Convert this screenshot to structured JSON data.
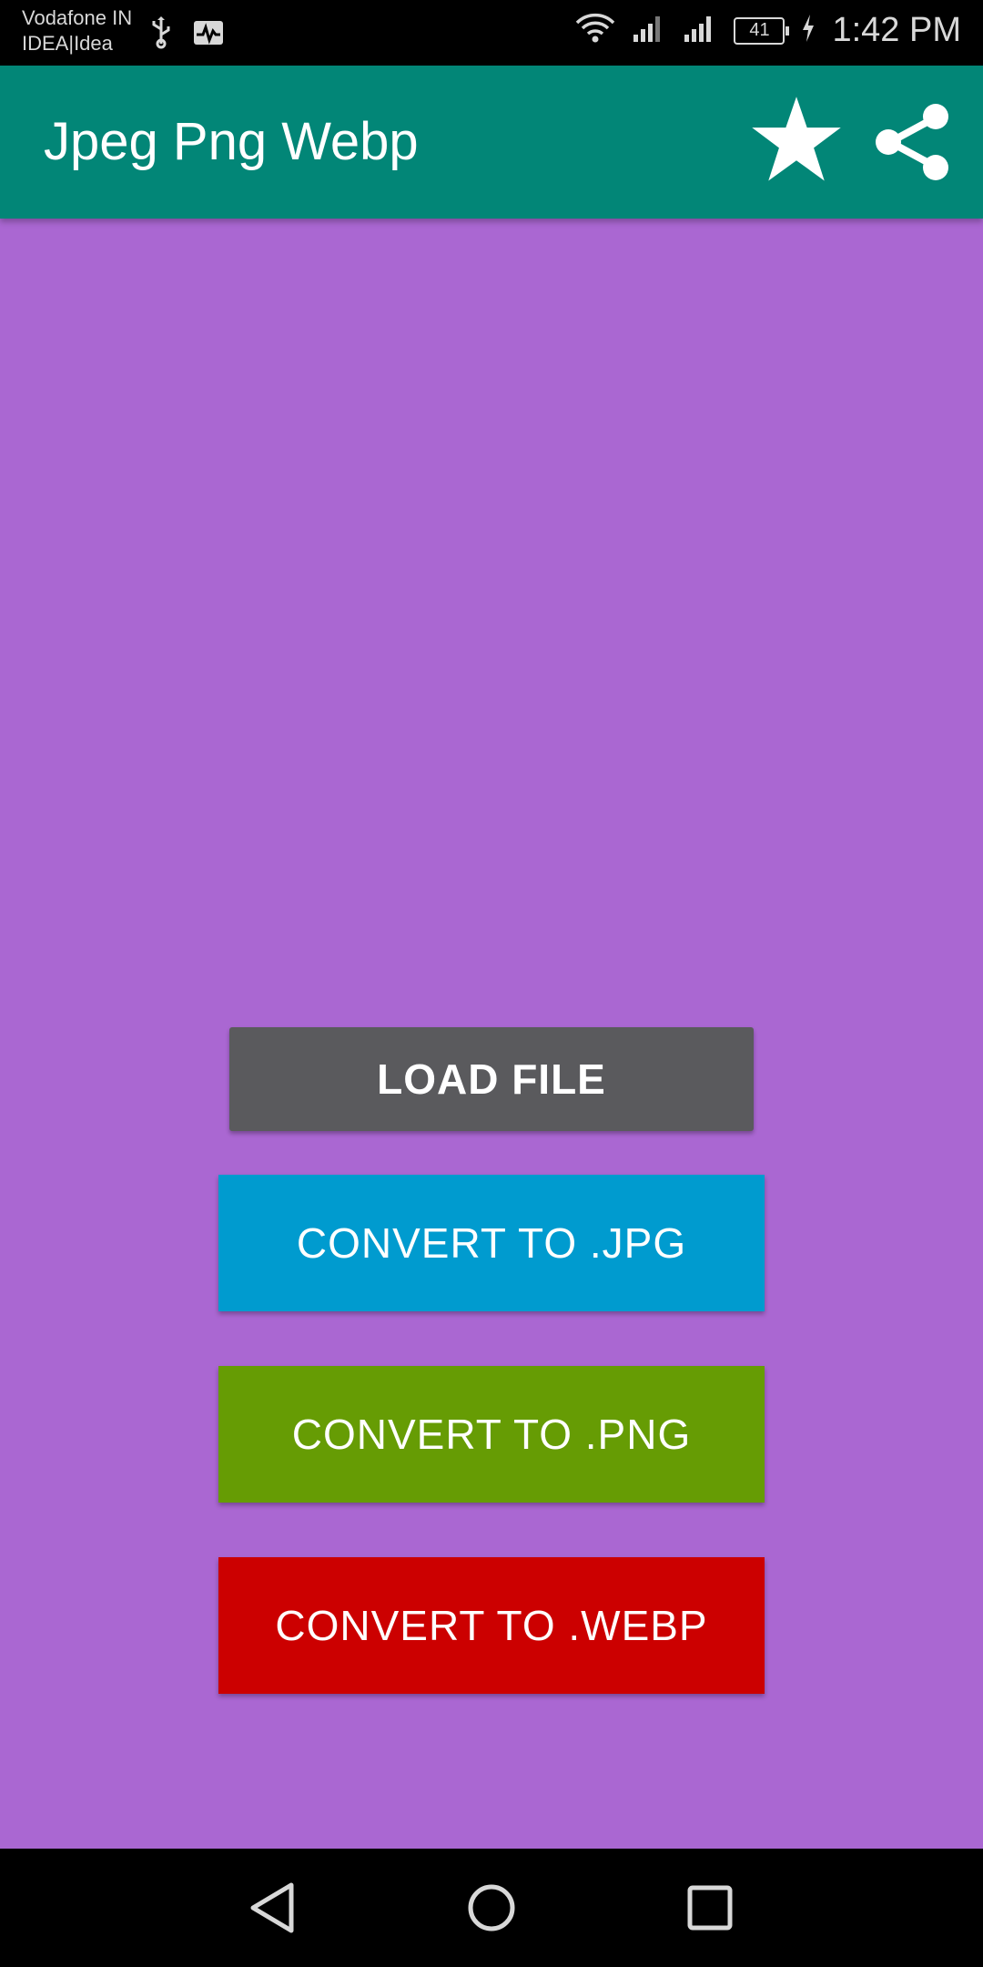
{
  "status_bar": {
    "carrier_line1": "Vodafone IN",
    "carrier_line2": "IDEA|Idea",
    "battery_level": "41",
    "time": "1:42 PM",
    "icons": [
      "usb-icon",
      "activity-icon",
      "wifi-icon",
      "signal-icon",
      "signal-icon",
      "battery-icon",
      "charging-icon"
    ]
  },
  "app_bar": {
    "title": "Jpeg Png Webp",
    "background": "#028677",
    "actions": [
      "star-icon",
      "share-icon"
    ]
  },
  "main": {
    "background": "#aa67d2",
    "buttons": [
      {
        "label": "LOAD FILE",
        "color": "#5a5a5d"
      },
      {
        "label": "CONVERT TO .JPG",
        "color": "#009bcf"
      },
      {
        "label": "CONVERT TO .PNG",
        "color": "#669c04"
      },
      {
        "label": "CONVERT TO .WEBP",
        "color": "#cc0000"
      }
    ]
  },
  "nav_bar": {
    "icons": [
      "back-icon",
      "home-icon",
      "recents-icon"
    ]
  }
}
